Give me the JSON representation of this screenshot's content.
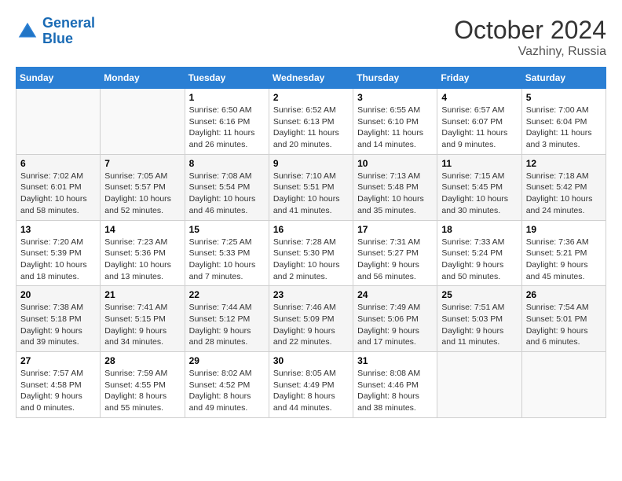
{
  "header": {
    "logo_line1": "General",
    "logo_line2": "Blue",
    "month": "October 2024",
    "location": "Vazhiny, Russia"
  },
  "weekdays": [
    "Sunday",
    "Monday",
    "Tuesday",
    "Wednesday",
    "Thursday",
    "Friday",
    "Saturday"
  ],
  "weeks": [
    [
      {
        "day": "",
        "info": ""
      },
      {
        "day": "",
        "info": ""
      },
      {
        "day": "1",
        "info": "Sunrise: 6:50 AM\nSunset: 6:16 PM\nDaylight: 11 hours\nand 26 minutes."
      },
      {
        "day": "2",
        "info": "Sunrise: 6:52 AM\nSunset: 6:13 PM\nDaylight: 11 hours\nand 20 minutes."
      },
      {
        "day": "3",
        "info": "Sunrise: 6:55 AM\nSunset: 6:10 PM\nDaylight: 11 hours\nand 14 minutes."
      },
      {
        "day": "4",
        "info": "Sunrise: 6:57 AM\nSunset: 6:07 PM\nDaylight: 11 hours\nand 9 minutes."
      },
      {
        "day": "5",
        "info": "Sunrise: 7:00 AM\nSunset: 6:04 PM\nDaylight: 11 hours\nand 3 minutes."
      }
    ],
    [
      {
        "day": "6",
        "info": "Sunrise: 7:02 AM\nSunset: 6:01 PM\nDaylight: 10 hours\nand 58 minutes."
      },
      {
        "day": "7",
        "info": "Sunrise: 7:05 AM\nSunset: 5:57 PM\nDaylight: 10 hours\nand 52 minutes."
      },
      {
        "day": "8",
        "info": "Sunrise: 7:08 AM\nSunset: 5:54 PM\nDaylight: 10 hours\nand 46 minutes."
      },
      {
        "day": "9",
        "info": "Sunrise: 7:10 AM\nSunset: 5:51 PM\nDaylight: 10 hours\nand 41 minutes."
      },
      {
        "day": "10",
        "info": "Sunrise: 7:13 AM\nSunset: 5:48 PM\nDaylight: 10 hours\nand 35 minutes."
      },
      {
        "day": "11",
        "info": "Sunrise: 7:15 AM\nSunset: 5:45 PM\nDaylight: 10 hours\nand 30 minutes."
      },
      {
        "day": "12",
        "info": "Sunrise: 7:18 AM\nSunset: 5:42 PM\nDaylight: 10 hours\nand 24 minutes."
      }
    ],
    [
      {
        "day": "13",
        "info": "Sunrise: 7:20 AM\nSunset: 5:39 PM\nDaylight: 10 hours\nand 18 minutes."
      },
      {
        "day": "14",
        "info": "Sunrise: 7:23 AM\nSunset: 5:36 PM\nDaylight: 10 hours\nand 13 minutes."
      },
      {
        "day": "15",
        "info": "Sunrise: 7:25 AM\nSunset: 5:33 PM\nDaylight: 10 hours\nand 7 minutes."
      },
      {
        "day": "16",
        "info": "Sunrise: 7:28 AM\nSunset: 5:30 PM\nDaylight: 10 hours\nand 2 minutes."
      },
      {
        "day": "17",
        "info": "Sunrise: 7:31 AM\nSunset: 5:27 PM\nDaylight: 9 hours\nand 56 minutes."
      },
      {
        "day": "18",
        "info": "Sunrise: 7:33 AM\nSunset: 5:24 PM\nDaylight: 9 hours\nand 50 minutes."
      },
      {
        "day": "19",
        "info": "Sunrise: 7:36 AM\nSunset: 5:21 PM\nDaylight: 9 hours\nand 45 minutes."
      }
    ],
    [
      {
        "day": "20",
        "info": "Sunrise: 7:38 AM\nSunset: 5:18 PM\nDaylight: 9 hours\nand 39 minutes."
      },
      {
        "day": "21",
        "info": "Sunrise: 7:41 AM\nSunset: 5:15 PM\nDaylight: 9 hours\nand 34 minutes."
      },
      {
        "day": "22",
        "info": "Sunrise: 7:44 AM\nSunset: 5:12 PM\nDaylight: 9 hours\nand 28 minutes."
      },
      {
        "day": "23",
        "info": "Sunrise: 7:46 AM\nSunset: 5:09 PM\nDaylight: 9 hours\nand 22 minutes."
      },
      {
        "day": "24",
        "info": "Sunrise: 7:49 AM\nSunset: 5:06 PM\nDaylight: 9 hours\nand 17 minutes."
      },
      {
        "day": "25",
        "info": "Sunrise: 7:51 AM\nSunset: 5:03 PM\nDaylight: 9 hours\nand 11 minutes."
      },
      {
        "day": "26",
        "info": "Sunrise: 7:54 AM\nSunset: 5:01 PM\nDaylight: 9 hours\nand 6 minutes."
      }
    ],
    [
      {
        "day": "27",
        "info": "Sunrise: 7:57 AM\nSunset: 4:58 PM\nDaylight: 9 hours\nand 0 minutes."
      },
      {
        "day": "28",
        "info": "Sunrise: 7:59 AM\nSunset: 4:55 PM\nDaylight: 8 hours\nand 55 minutes."
      },
      {
        "day": "29",
        "info": "Sunrise: 8:02 AM\nSunset: 4:52 PM\nDaylight: 8 hours\nand 49 minutes."
      },
      {
        "day": "30",
        "info": "Sunrise: 8:05 AM\nSunset: 4:49 PM\nDaylight: 8 hours\nand 44 minutes."
      },
      {
        "day": "31",
        "info": "Sunrise: 8:08 AM\nSunset: 4:46 PM\nDaylight: 8 hours\nand 38 minutes."
      },
      {
        "day": "",
        "info": ""
      },
      {
        "day": "",
        "info": ""
      }
    ]
  ]
}
